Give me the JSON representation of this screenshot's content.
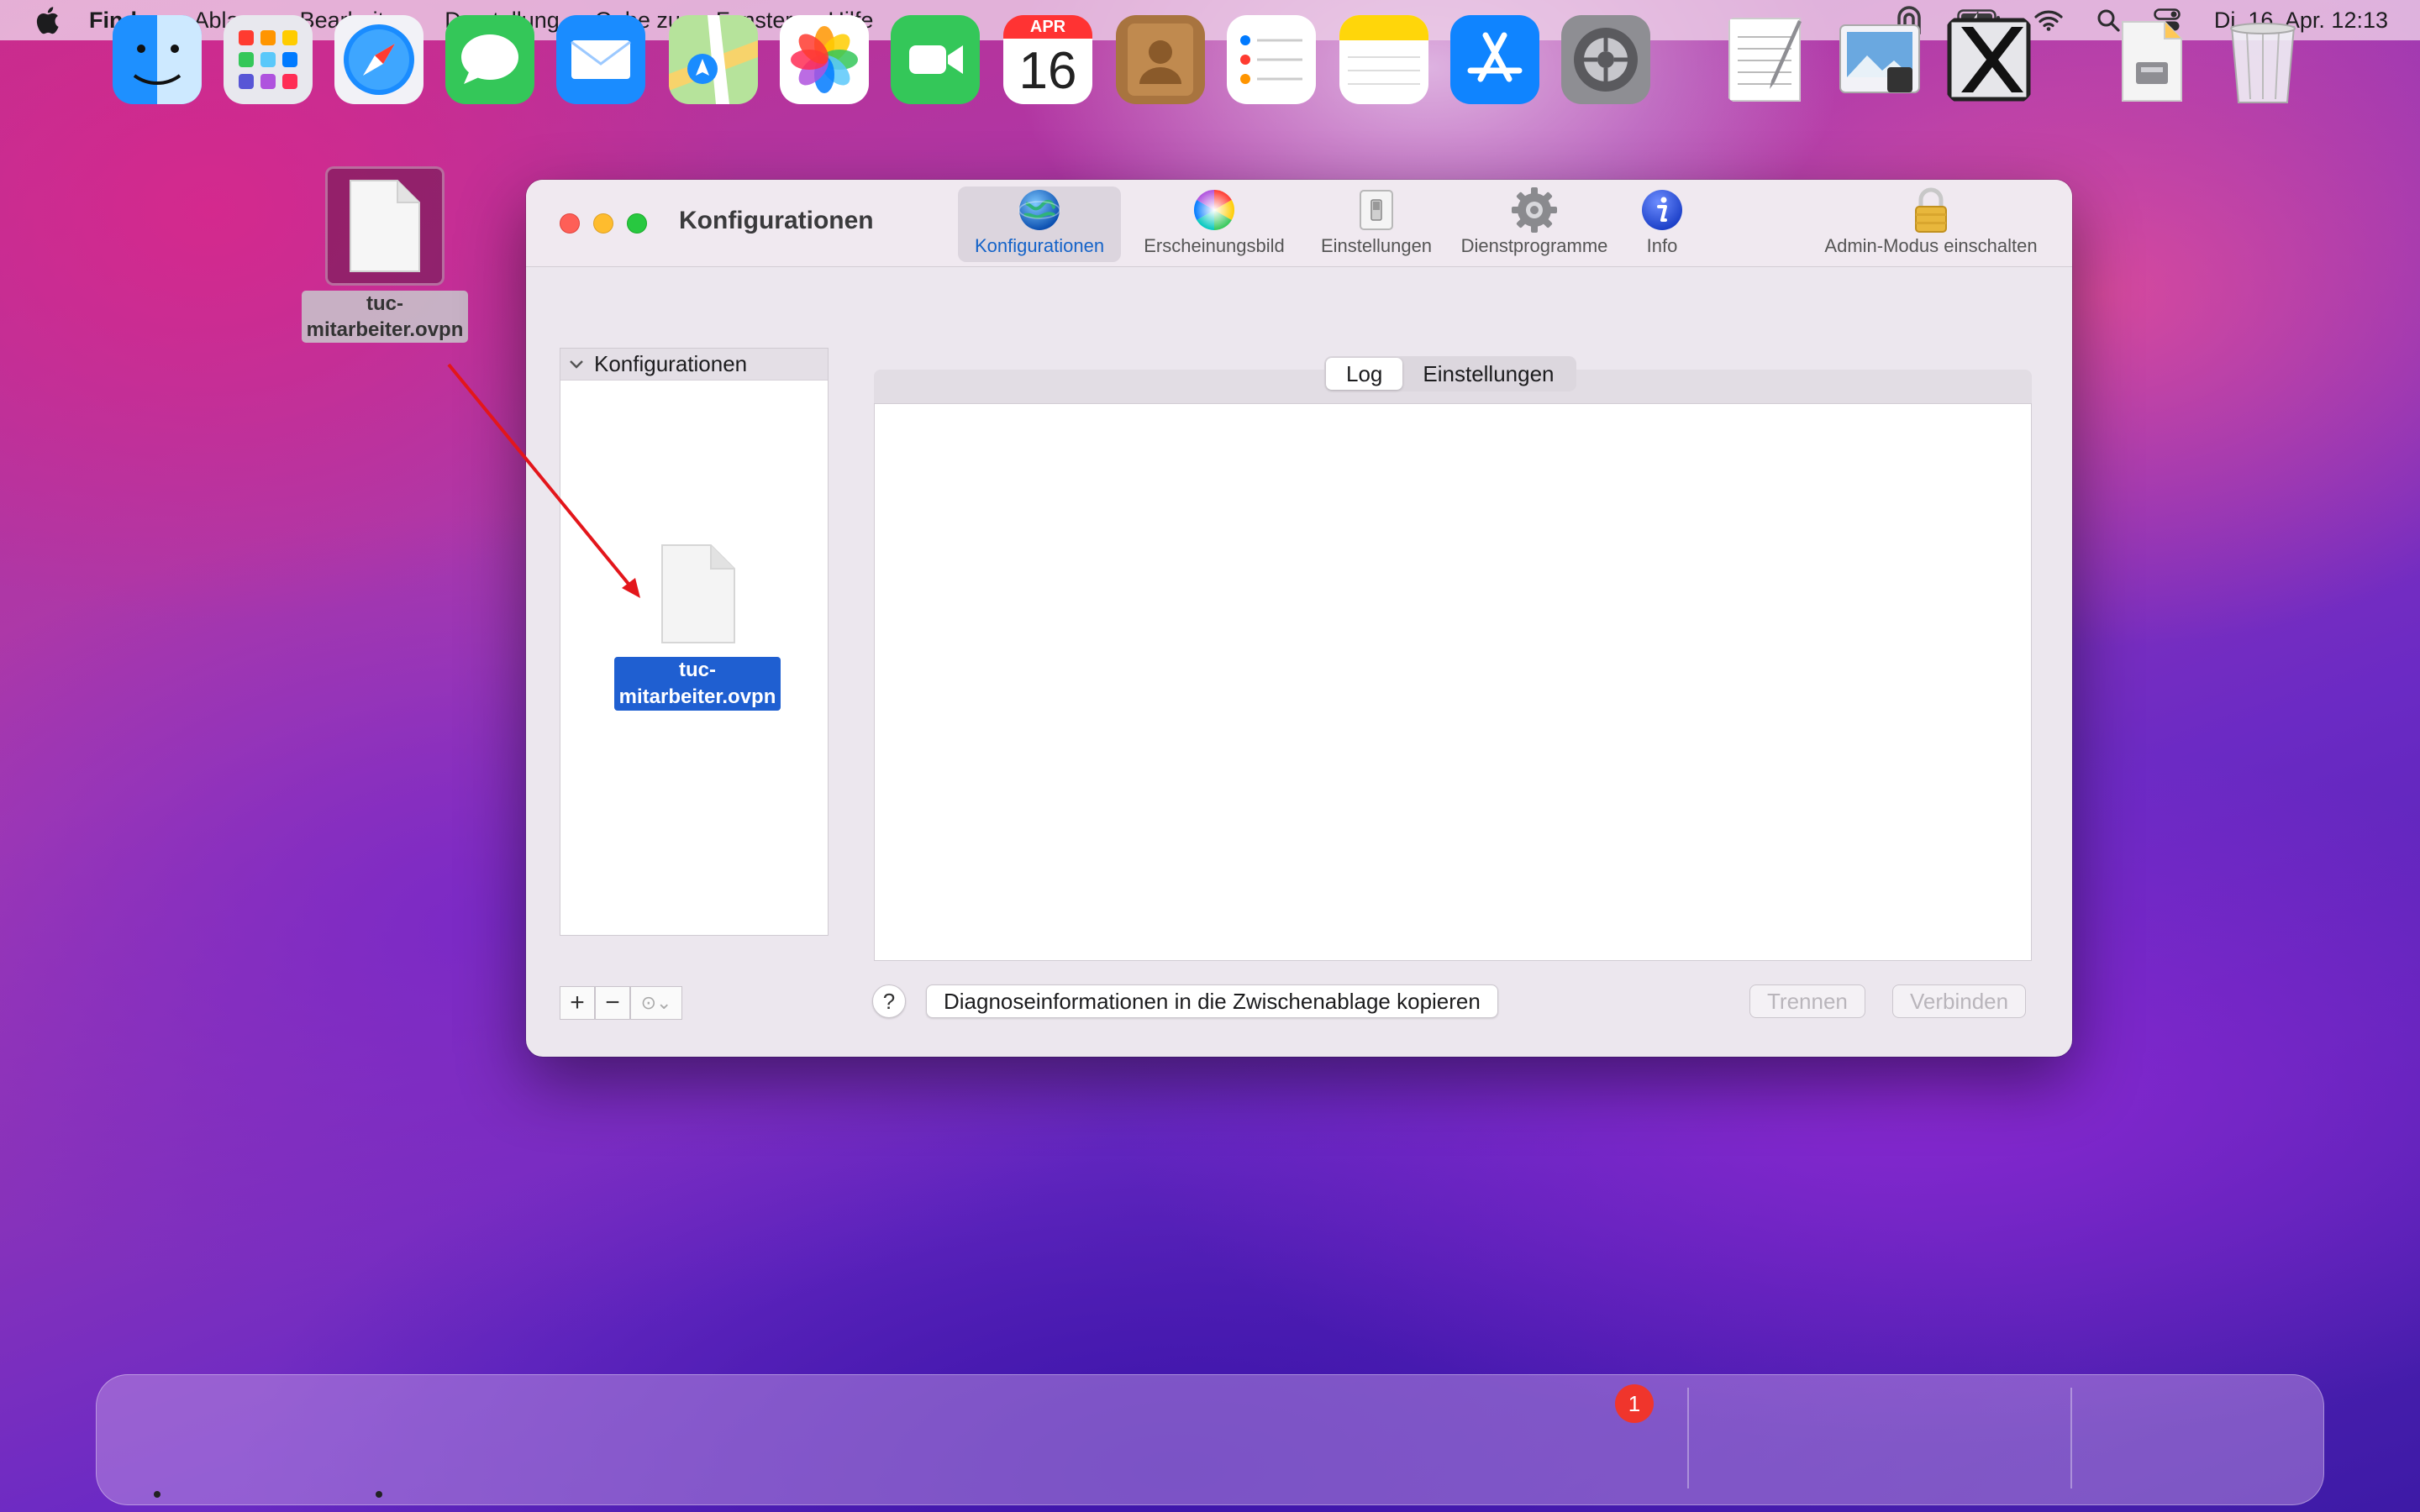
{
  "menubar": {
    "app_name": "Finder",
    "items": [
      "Ablage",
      "Bearbeiten",
      "Darstellung",
      "Gehe zu",
      "Fenster",
      "Hilfe"
    ],
    "clock": "Di. 16. Apr.  12:13"
  },
  "desktop": {
    "file_label_line1": "tuc-",
    "file_label_line2": "mitarbeiter.ovpn"
  },
  "window": {
    "title": "Konfigurationen",
    "toolbar": {
      "konfigurationen": "Konfigurationen",
      "erscheinungsbild": "Erscheinungsbild",
      "einstellungen": "Einstellungen",
      "dienstprogramme": "Dienstprogramme",
      "info": "Info",
      "admin": "Admin-Modus einschalten"
    },
    "sidebar": {
      "header": "Konfigurationen",
      "add": "+",
      "remove": "−",
      "more": "⊙⌄"
    },
    "drag_ghost": {
      "label_line1": "tuc-",
      "label_line2": "mitarbeiter.ovpn"
    },
    "tabs": {
      "log": "Log",
      "settings": "Einstellungen",
      "selected": "Log"
    },
    "buttons": {
      "help": "?",
      "copy_diagnostics": "Diagnoseinformationen in die Zwischenablage kopieren",
      "disconnect": "Trennen",
      "connect": "Verbinden"
    }
  },
  "dock": {
    "calendar_month": "APR",
    "calendar_day": "16",
    "settings_badge": "1",
    "apps": [
      "finder-icon",
      "launchpad-icon",
      "safari-icon",
      "messages-icon",
      "mail-icon",
      "maps-icon",
      "photos-icon",
      "facetime-icon",
      "calendar-icon",
      "contacts-icon",
      "reminders-icon",
      "notes-icon",
      "app-store-icon",
      "system-preferences-icon",
      "textedit-icon",
      "preview-icon",
      "x11-icon",
      "downloads-icon",
      "trash-icon"
    ]
  },
  "colors": {
    "accent": "#1463c8",
    "selection": "#1f5fd1",
    "arrow": "#e3161b"
  }
}
